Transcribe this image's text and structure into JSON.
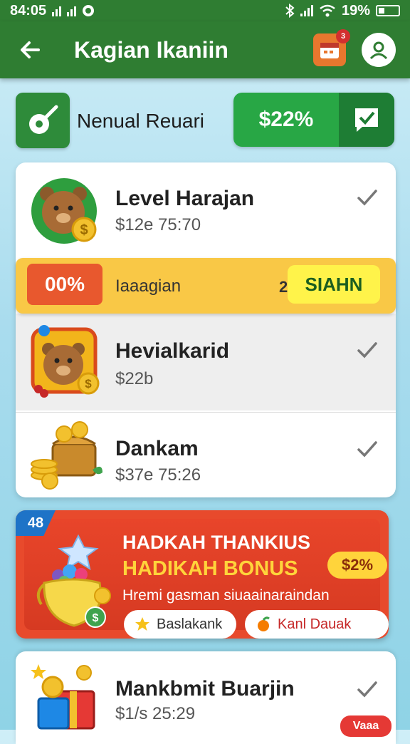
{
  "status_bar": {
    "time": "84:05",
    "battery": "19%"
  },
  "app_bar": {
    "title": "Kagian Ikaniin",
    "calendar_badge": "3"
  },
  "top_card": {
    "label": "Nenual Reuari",
    "value": "$22%"
  },
  "list": [
    {
      "title": "Level Harajan",
      "subtitle": "$12e 75:70"
    },
    {
      "title": "Hevialkarid",
      "subtitle": "$22b"
    },
    {
      "title": "Dankam",
      "subtitle": "$37e 75:26"
    }
  ],
  "banner": {
    "percent": "00%",
    "label": "Iaaagian",
    "number": "2",
    "button": "SIAHN"
  },
  "bonus": {
    "tag": "48",
    "title1": "HADKAH THANKIUS",
    "title2": "HADIKAH BONUS",
    "percent": "$2%",
    "description": "Hremi gasman siuaainaraindan",
    "button1": "Baslakank",
    "button2": "Kanl Dauak"
  },
  "bottom_card": {
    "title": "Mankbmit Buarjin",
    "subtitle": "$1/s 25:29",
    "badge": "Vaaa"
  }
}
